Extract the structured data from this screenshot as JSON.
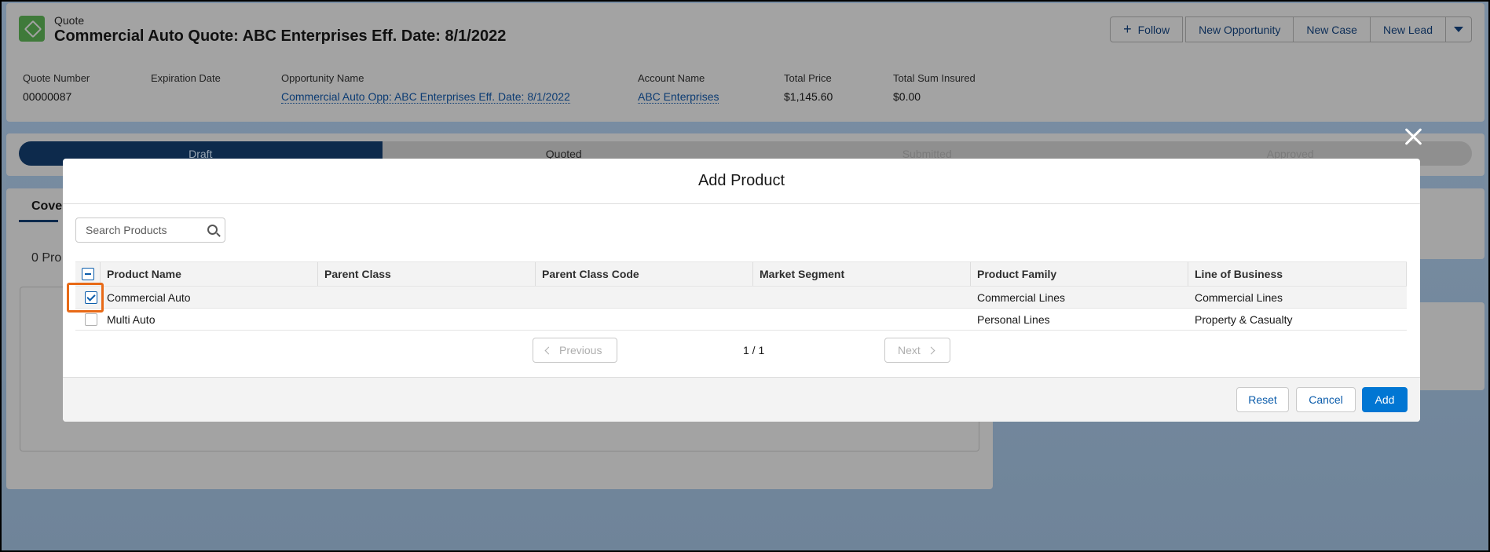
{
  "header": {
    "object_type": "Quote",
    "title": "Commercial Auto Quote: ABC Enterprises Eff. Date: 8/1/2022",
    "buttons": {
      "follow": "Follow",
      "new_opportunity": "New Opportunity",
      "new_case": "New Case",
      "new_lead": "New Lead"
    },
    "fields": [
      {
        "label": "Quote Number",
        "value": "00000087"
      },
      {
        "label": "Expiration Date",
        "value": ""
      },
      {
        "label": "Opportunity Name",
        "value": "Commercial Auto Opp: ABC Enterprises Eff. Date: 8/1/2022"
      },
      {
        "label": "Account Name",
        "value": "ABC Enterprises"
      },
      {
        "label": "Total Price",
        "value": "$1,145.60"
      },
      {
        "label": "Total Sum Insured",
        "value": "$0.00"
      }
    ]
  },
  "path": {
    "stages": [
      "Draft",
      "Quoted",
      "Submitted",
      "Approved"
    ]
  },
  "left_panel": {
    "tab": "Cove",
    "count": "0 Pro"
  },
  "modal": {
    "title": "Add Product",
    "search_placeholder": "Search Products",
    "columns": [
      "Product Name",
      "Parent Class",
      "Parent Class Code",
      "Market Segment",
      "Product Family",
      "Line of Business"
    ],
    "rows": [
      {
        "checked": true,
        "product_name": "Commercial Auto",
        "parent_class": "",
        "parent_class_code": "",
        "market_segment": "",
        "product_family": "Commercial Lines",
        "line_of_business": "Commercial Lines"
      },
      {
        "checked": false,
        "product_name": "Multi Auto",
        "parent_class": "",
        "parent_class_code": "",
        "market_segment": "",
        "product_family": "Personal Lines",
        "line_of_business": "Property & Casualty"
      }
    ],
    "pager": {
      "previous": "Previous",
      "page": "1 / 1",
      "next": "Next"
    },
    "footer": {
      "reset": "Reset",
      "cancel": "Cancel",
      "add": "Add"
    }
  },
  "colors": {
    "brand_blue": "#0176d3",
    "highlight_orange": "#e86a17",
    "quote_icon_green": "#3f7a3a"
  }
}
